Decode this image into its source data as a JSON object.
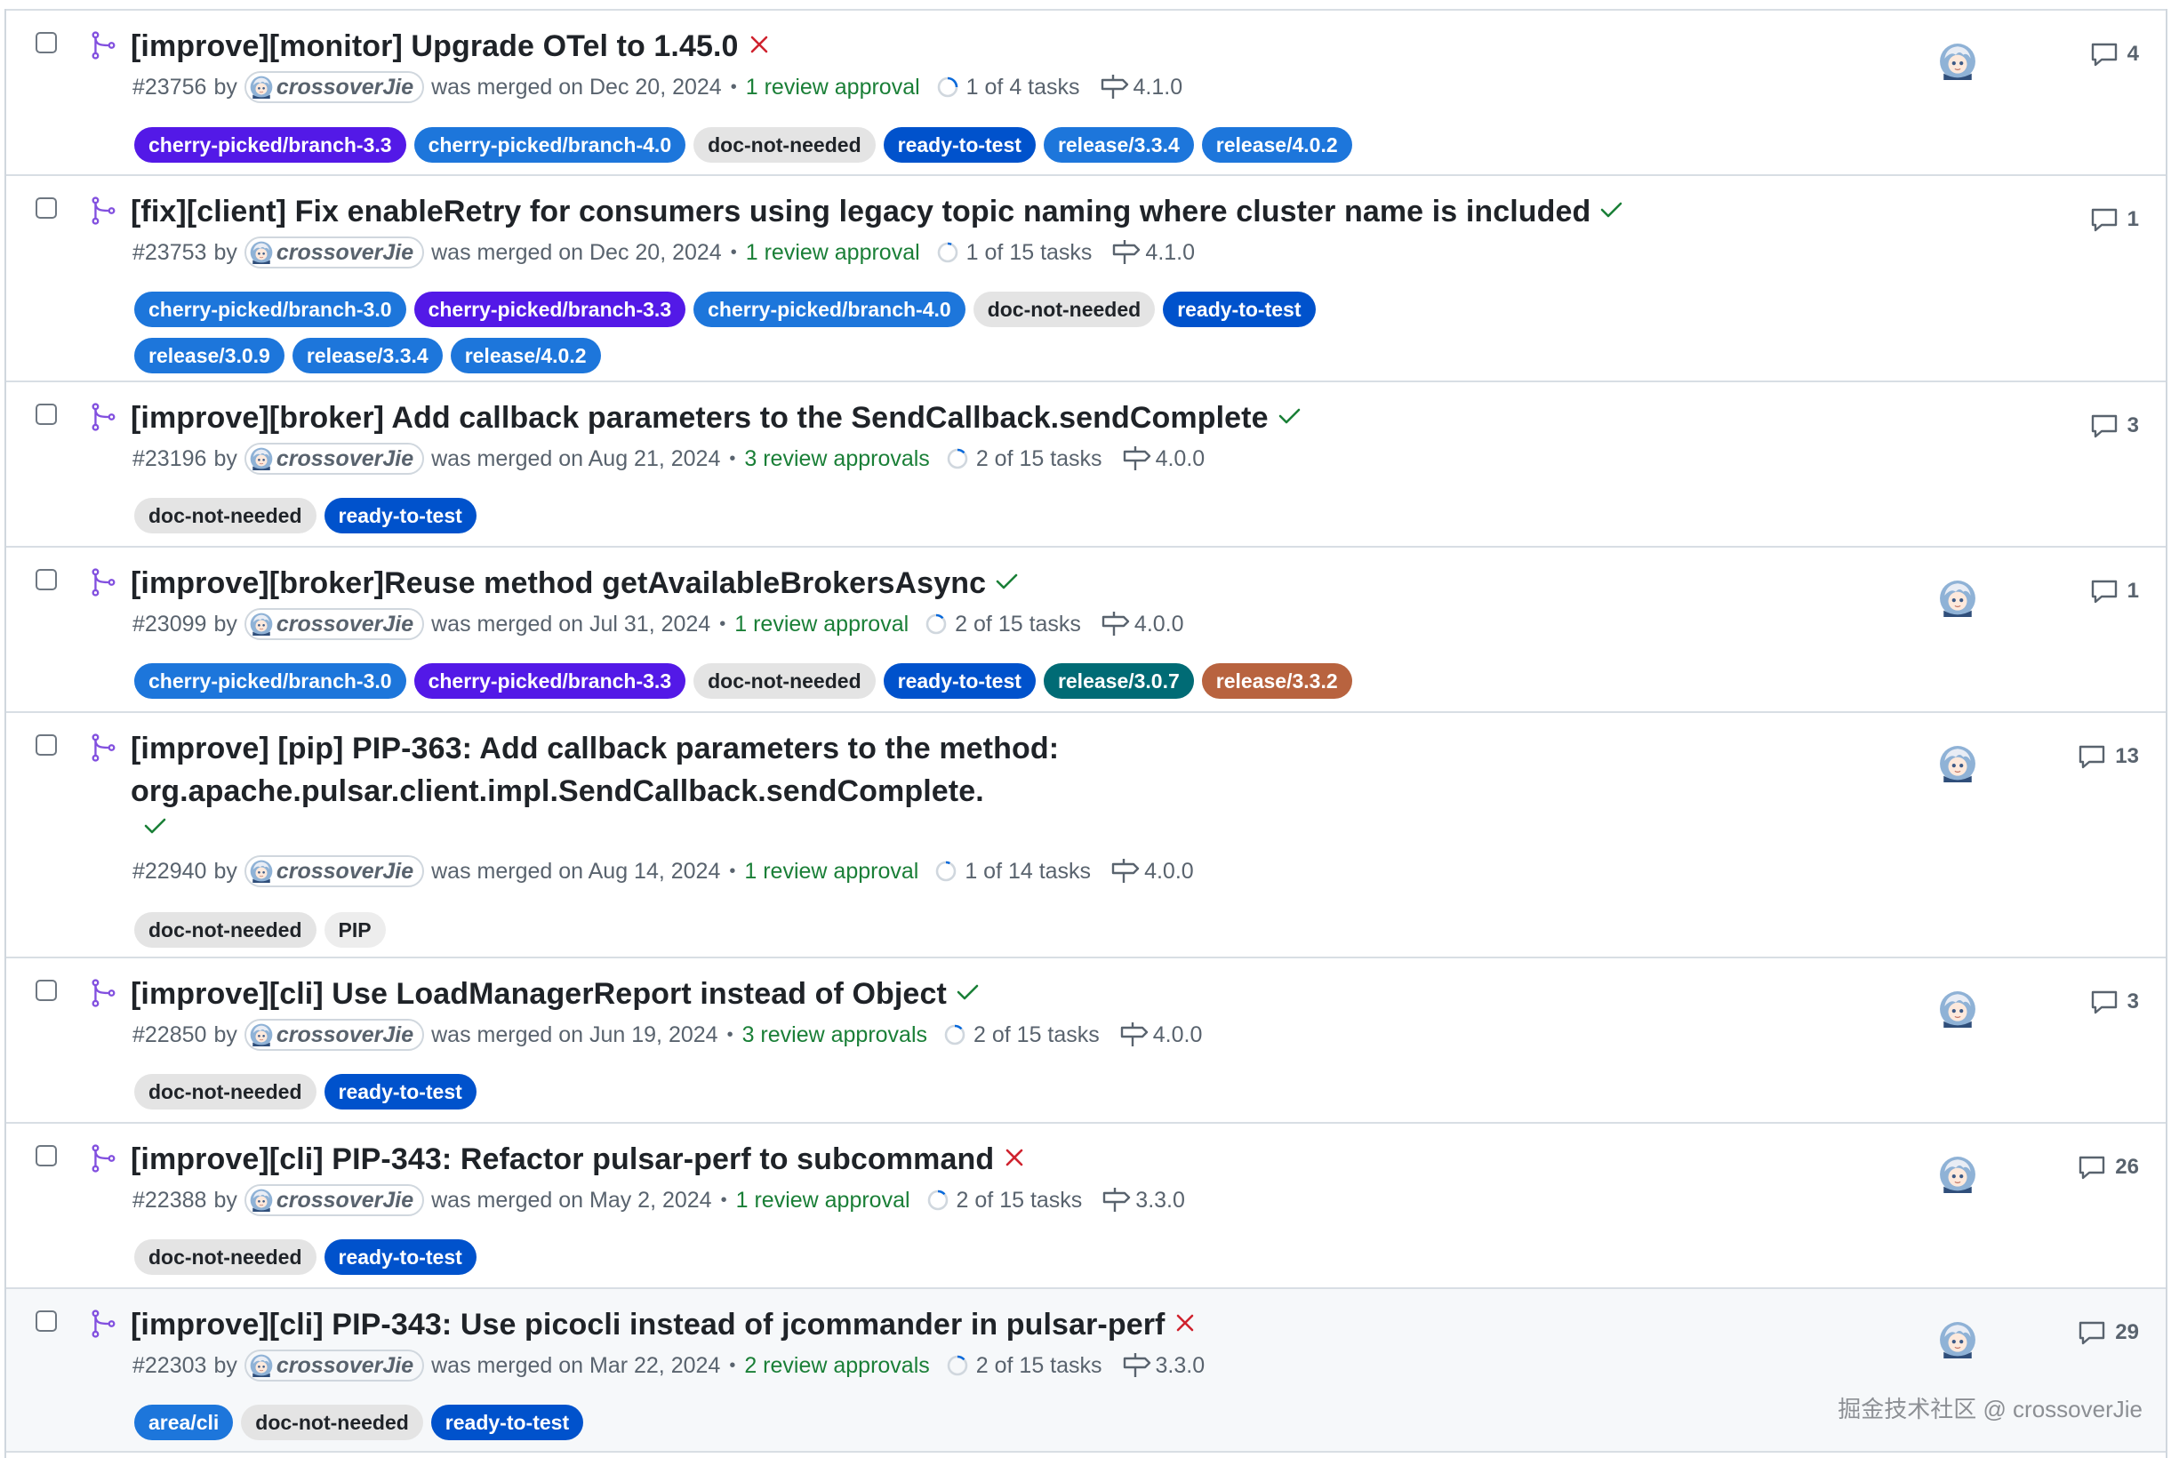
{
  "colors": {
    "cherry-picked/branch-3.3": "#5319e7",
    "cherry-picked/branch-3.0": "#1d76db",
    "cherry-picked/branch-4.0": "#1d76db",
    "doc-not-needed": "#e4e4e4",
    "ready-to-test": "#0052cc",
    "release/3.3.4": "#1d76db",
    "release/4.0.2": "#1d76db",
    "release/3.0.9": "#1d76db",
    "release/3.0.7": "#006b75",
    "release/3.3.2": "#b8633f",
    "area/cli": "#1d76db",
    "PIP": "#ededed",
    "merged_icon": "#8250df",
    "success": "#1a7f37",
    "failure": "#cf222e"
  },
  "pull_requests": [
    {
      "title": "[improve][monitor] Upgrade OTel to 1.45.0",
      "status_icon": "x-icon",
      "number": "#23756",
      "by": "by",
      "author": "crossoverJie",
      "merged_text": "was merged on Dec 20, 2024",
      "dot": "•",
      "approvals": "1 review approval",
      "tasks": "1 of 4 tasks",
      "milestone": "4.1.0",
      "labels": [
        "cherry-picked/branch-3.3",
        "cherry-picked/branch-4.0",
        "doc-not-needed",
        "ready-to-test",
        "release/3.3.4",
        "release/4.0.2"
      ],
      "has_assignee": true,
      "comments": "4"
    },
    {
      "title": "[fix][client] Fix enableRetry for consumers using legacy topic naming where cluster name is included",
      "status_icon": "check-icon",
      "number": "#23753",
      "by": "by",
      "author": "crossoverJie",
      "merged_text": "was merged on Dec 20, 2024",
      "dot": "•",
      "approvals": "1 review approval",
      "tasks": "1 of 15 tasks",
      "milestone": "4.1.0",
      "labels": [
        "cherry-picked/branch-3.0",
        "cherry-picked/branch-3.3",
        "cherry-picked/branch-4.0",
        "doc-not-needed",
        "ready-to-test",
        "release/3.0.9",
        "release/3.3.4",
        "release/4.0.2"
      ],
      "has_assignee": false,
      "comments": "1"
    },
    {
      "title": "[improve][broker] Add callback parameters to the SendCallback.sendComplete",
      "status_icon": "check-icon",
      "number": "#23196",
      "by": "by",
      "author": "crossoverJie",
      "merged_text": "was merged on Aug 21, 2024",
      "dot": "•",
      "approvals": "3 review approvals",
      "tasks": "2 of 15 tasks",
      "milestone": "4.0.0",
      "labels": [
        "doc-not-needed",
        "ready-to-test"
      ],
      "has_assignee": false,
      "comments": "3"
    },
    {
      "title": "[improve][broker]Reuse method getAvailableBrokersAsync",
      "status_icon": "check-icon",
      "number": "#23099",
      "by": "by",
      "author": "crossoverJie",
      "merged_text": "was merged on Jul 31, 2024",
      "dot": "•",
      "approvals": "1 review approval",
      "tasks": "2 of 15 tasks",
      "milestone": "4.0.0",
      "labels": [
        "cherry-picked/branch-3.0",
        "cherry-picked/branch-3.3",
        "doc-not-needed",
        "ready-to-test",
        "release/3.0.7",
        "release/3.3.2"
      ],
      "has_assignee": true,
      "comments": "1"
    },
    {
      "title": "[improve] [pip] PIP-363: Add callback parameters to the method: org.apache.pulsar.client.impl.SendCallback.sendComplete.",
      "status_icon": "check-icon",
      "number": "#22940",
      "by": "by",
      "author": "crossoverJie",
      "merged_text": "was merged on Aug 14, 2024",
      "dot": "•",
      "approvals": "1 review approval",
      "tasks": "1 of 14 tasks",
      "milestone": "4.0.0",
      "labels": [
        "doc-not-needed",
        "PIP"
      ],
      "has_assignee": true,
      "comments": "13"
    },
    {
      "title": "[improve][cli] Use LoadManagerReport instead of Object",
      "status_icon": "check-icon",
      "number": "#22850",
      "by": "by",
      "author": "crossoverJie",
      "merged_text": "was merged on Jun 19, 2024",
      "dot": "•",
      "approvals": "3 review approvals",
      "tasks": "2 of 15 tasks",
      "milestone": "4.0.0",
      "labels": [
        "doc-not-needed",
        "ready-to-test"
      ],
      "has_assignee": true,
      "comments": "3"
    },
    {
      "title": "[improve][cli] PIP-343: Refactor pulsar-perf to subcommand",
      "status_icon": "x-icon",
      "number": "#22388",
      "by": "by",
      "author": "crossoverJie",
      "merged_text": "was merged on May 2, 2024",
      "dot": "•",
      "approvals": "1 review approval",
      "tasks": "2 of 15 tasks",
      "milestone": "3.3.0",
      "labels": [
        "doc-not-needed",
        "ready-to-test"
      ],
      "has_assignee": true,
      "comments": "26"
    },
    {
      "title": "[improve][cli] PIP-343: Use picocli instead of jcommander in pulsar-perf",
      "status_icon": "x-icon",
      "number": "#22303",
      "by": "by",
      "author": "crossoverJie",
      "merged_text": "was merged on Mar 22, 2024",
      "dot": "•",
      "approvals": "2 review approvals",
      "tasks": "2 of 15 tasks",
      "milestone": "3.3.0",
      "labels": [
        "area/cli",
        "doc-not-needed",
        "ready-to-test"
      ],
      "has_assignee": true,
      "comments": "29"
    }
  ],
  "watermark": "掘金技术社区 @ crossoverJie"
}
